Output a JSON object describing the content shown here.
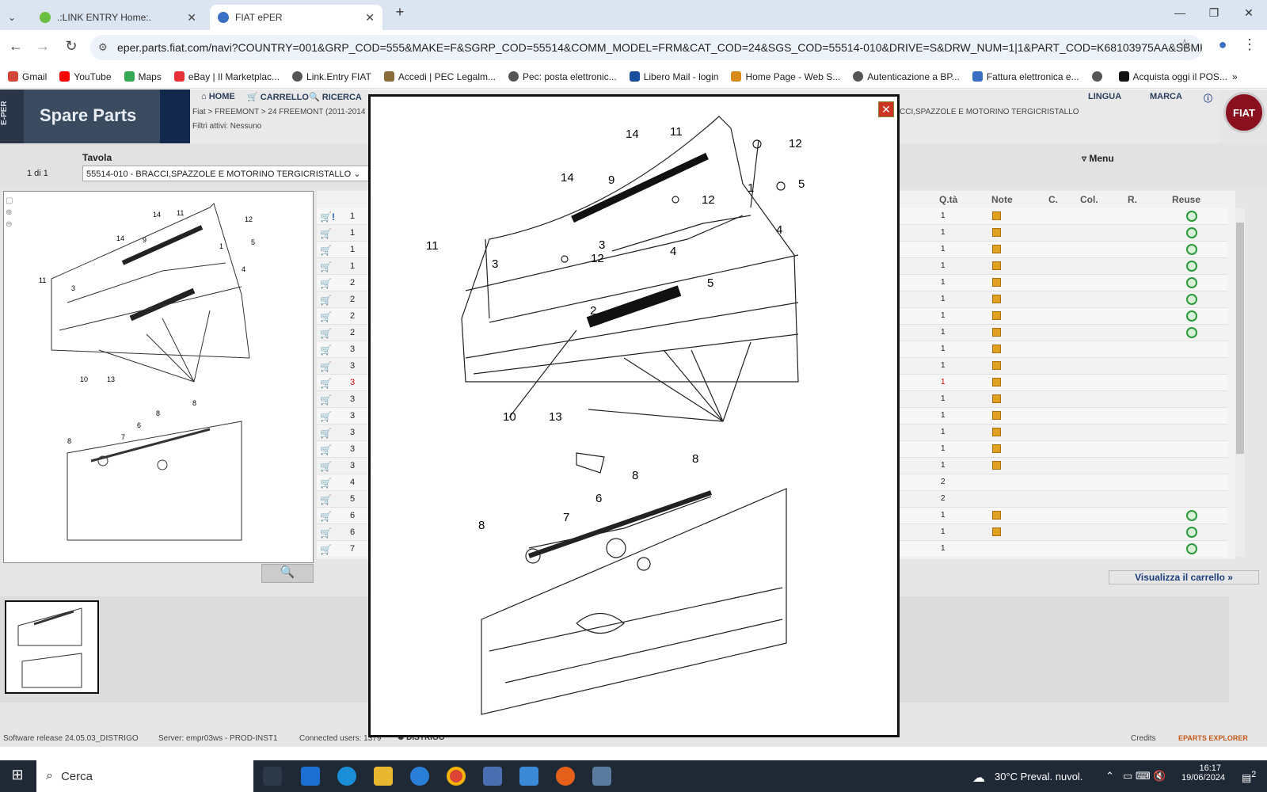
{
  "browser": {
    "tabs": [
      {
        "title": ".:LINK ENTRY Home:.",
        "active": false
      },
      {
        "title": "FIAT ePER",
        "active": true
      }
    ],
    "url": "eper.parts.fiat.com/navi?COUNTRY=001&GRP_COD=555&MAKE=F&SGRP_COD=55514&COMM_MODEL=FRM&CAT_COD=24&SGS_COD=55514-010&DRIVE=S&DRW_NUM=1|1&PART_COD=K68103975AA&SBMK=F&LANG...",
    "bookmarks": [
      "Gmail",
      "YouTube",
      "Maps",
      "eBay | Il Marketplac...",
      "Link.Entry FIAT",
      "Accedi | PEC Legalm...",
      "Pec: posta elettronic...",
      "Libero Mail - login",
      "Home Page - Web S...",
      "Autenticazione a BP...",
      "Fattura elettronica e...",
      "Acquista oggi il POS..."
    ]
  },
  "app": {
    "side_label": "E-PER",
    "title": "Spare Parts",
    "menu": [
      "HOME",
      "CARRELLO",
      "RICERCA"
    ],
    "menu_right": [
      "LINGUA",
      "MARCA"
    ],
    "breadcrumb": "Fiat > FREEMONT > 24 FREEMONT (2011-2014",
    "breadcrumb_right": "CCI,SPAZZOLE E MOTORINO TERGICRISTALLO",
    "filters": "Filtri attivi: Nessuno",
    "logo_text": "FIAT",
    "tavola_label": "Tavola",
    "page_count": "1 di 1",
    "tavola_value": "55514-010 - BRACCI,SPAZZOLE E MOTORINO TERGICRISTALLO",
    "menu_label": "Menu",
    "columns": [
      "Q.tà",
      "Note",
      "C.",
      "Col.",
      "R.",
      "Reuse"
    ],
    "rows": [
      {
        "n": "1",
        "q": "1",
        "note": true,
        "reuse": true,
        "warn": true
      },
      {
        "n": "1",
        "q": "1",
        "note": true,
        "reuse": true
      },
      {
        "n": "1",
        "q": "1",
        "note": true,
        "reuse": true
      },
      {
        "n": "1",
        "q": "1",
        "note": true,
        "reuse": true
      },
      {
        "n": "2",
        "q": "1",
        "note": true,
        "reuse": true
      },
      {
        "n": "2",
        "q": "1",
        "note": true,
        "reuse": true
      },
      {
        "n": "2",
        "q": "1",
        "note": true,
        "reuse": true
      },
      {
        "n": "2",
        "q": "1",
        "note": true,
        "reuse": true
      },
      {
        "n": "3",
        "q": "1",
        "note": true,
        "reuse": false
      },
      {
        "n": "3",
        "q": "1",
        "note": true,
        "reuse": false
      },
      {
        "n": "3",
        "q": "1",
        "note": true,
        "reuse": false,
        "red": true
      },
      {
        "n": "3",
        "q": "1",
        "note": true,
        "reuse": false
      },
      {
        "n": "3",
        "q": "1",
        "note": true,
        "reuse": false
      },
      {
        "n": "3",
        "q": "1",
        "note": true,
        "reuse": false
      },
      {
        "n": "3",
        "q": "1",
        "note": true,
        "reuse": false
      },
      {
        "n": "3",
        "q": "1",
        "note": true,
        "reuse": false
      },
      {
        "n": "4",
        "q": "2",
        "note": false,
        "reuse": false
      },
      {
        "n": "5",
        "q": "2",
        "note": false,
        "reuse": false
      },
      {
        "n": "6",
        "q": "1",
        "note": true,
        "reuse": true
      },
      {
        "n": "6",
        "q": "1",
        "note": true,
        "reuse": true
      },
      {
        "n": "7",
        "q": "1",
        "note": false,
        "reuse": true
      }
    ],
    "cart_link": "Visualizza il carrello »",
    "status": [
      "Software release 24.05.03_DISTRIGO",
      "Server: empr03ws - PROD-INST1",
      "Connected users: 1379",
      "DISTRIGO"
    ],
    "credits": "Credits",
    "explorer": "EPARTS EXPLORER"
  },
  "diagram_labels": {
    "top": [
      "14",
      "11",
      "12",
      "14",
      "9",
      "12",
      "1",
      "5",
      "11",
      "3",
      "12",
      "4",
      "3",
      "5",
      "2",
      "10",
      "13"
    ],
    "bottom": [
      "8",
      "8",
      "6",
      "7",
      "8"
    ]
  },
  "taskbar": {
    "search_placeholder": "Cerca",
    "weather": "30°C  Preval. nuvol.",
    "time": "16:17",
    "date": "19/06/2024",
    "notif": "2"
  }
}
